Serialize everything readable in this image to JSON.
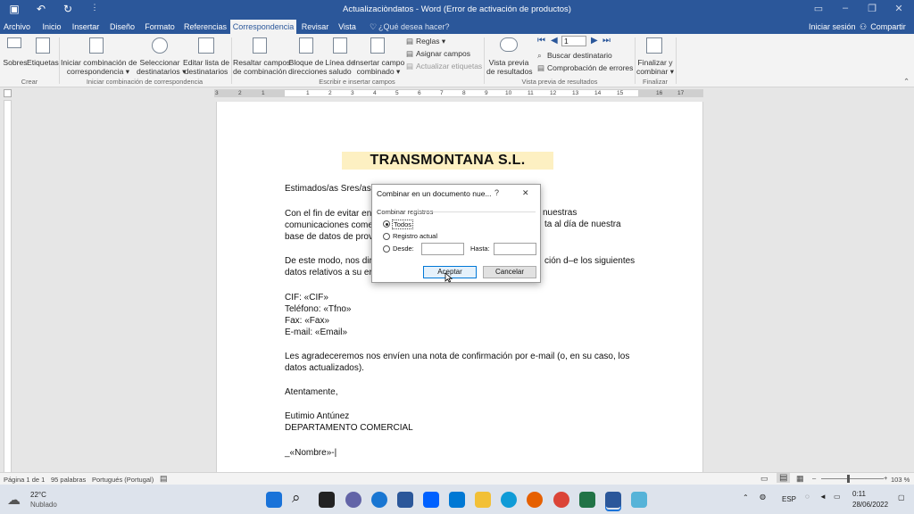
{
  "title_bar": {
    "title": "Actualizaciòndatos - Word (Error de activación de productos)",
    "quick_access": {
      "save": "save-icon",
      "undo": "undo-icon",
      "redo": "redo-icon",
      "customize": "customize-icon"
    }
  },
  "tabs": [
    "Archivo",
    "Inicio",
    "Insertar",
    "Diseño",
    "Formato",
    "Referencias",
    "Correspondencia",
    "Revisar",
    "Vista"
  ],
  "active_tab": "Correspondencia",
  "search_placeholder": "¿Qué desea hacer?",
  "account": {
    "signin": "Iniciar sesión",
    "share": "Compartir"
  },
  "ribbon": {
    "groups": [
      "Crear",
      "Iniciar combinación de correspondencia",
      "Escribir e insertar campos",
      "Vista previa de resultados",
      "Finalizar"
    ],
    "sobres": "Sobres",
    "etiquetas": "Etiquetas",
    "iniciar_l1": "Iniciar combinación de",
    "iniciar_l2": "correspondencia ▾",
    "seleccionar_l1": "Seleccionar",
    "seleccionar_l2": "destinatarios ▾",
    "editar_l1": "Editar lista de",
    "editar_l2": "destinatarios",
    "resaltar_l1": "Resaltar campos",
    "resaltar_l2": "de combinación",
    "bloque_l1": "Bloque de",
    "bloque_l2": "direcciones",
    "linea_l1": "Línea de",
    "linea_l2": "saludo",
    "insertar_l1": "Insertar campo",
    "insertar_l2": "combinado ▾",
    "reglas": "Reglas ▾",
    "asignar": "Asignar campos",
    "actualizar": "Actualizar etiquetas",
    "vista_l1": "Vista previa",
    "vista_l2": "de resultados",
    "record_value": "1",
    "buscar": "Buscar destinatario",
    "comprobacion": "Comprobación de errores",
    "finalizar_l1": "Finalizar y",
    "finalizar_l2": "combinar ▾"
  },
  "ruler_numbers": [
    "3",
    "2",
    "1",
    "1",
    "2",
    "3",
    "4",
    "5",
    "6",
    "7",
    "8",
    "9",
    "10",
    "11",
    "12",
    "13",
    "14",
    "15",
    "16",
    "17"
  ],
  "document": {
    "banner": "TRANSMONTANA S.L.",
    "lines": [
      "Estimados/as Sres/as.",
      "Con el fin de evitar en",
      "comunicaciones come",
      "base de datos de prov",
      "De este modo, nos dir",
      "datos relativos a su er",
      "CIF: «CIF»",
      "Teléfono: «Tfno»",
      "Fax: «Fax»",
      "E-mail: «Email»",
      "Les agradeceremos nos envíen una nota de confirmación por e-mail (o, en su caso, los",
      "datos actualizados).",
      "Atentamente,",
      "Eutimio Antúnez",
      "DEPARTAMENTO COMERCIAL",
      "_«Nombre»-|"
    ],
    "right_fragments": [
      "nuestras",
      "ta al día de nuestra",
      "ción d–e los siguientes"
    ]
  },
  "dialog": {
    "title": "Combinar en un documento nue...",
    "help": "?",
    "close": "✕",
    "group_label": "Combinar registros",
    "option_all": "Todos",
    "option_current": "Registro actual",
    "option_from": "Desde:",
    "to_label": "Hasta:",
    "selected": "Todos",
    "ok": "Aceptar",
    "cancel": "Cancelar"
  },
  "status_bar": {
    "page": "Página 1 de 1",
    "words": "95 palabras",
    "language": "Portugués (Portugal)",
    "zoom": "103 %"
  },
  "taskbar": {
    "weather_temp": "22°C",
    "weather_desc": "Nublado",
    "lang": "ESP",
    "time": "0:11",
    "date": "28/06/2022"
  },
  "colors": {
    "word_blue": "#2b579a",
    "banner_fill": "#fdf0c2",
    "default_button": "#0078d7"
  }
}
